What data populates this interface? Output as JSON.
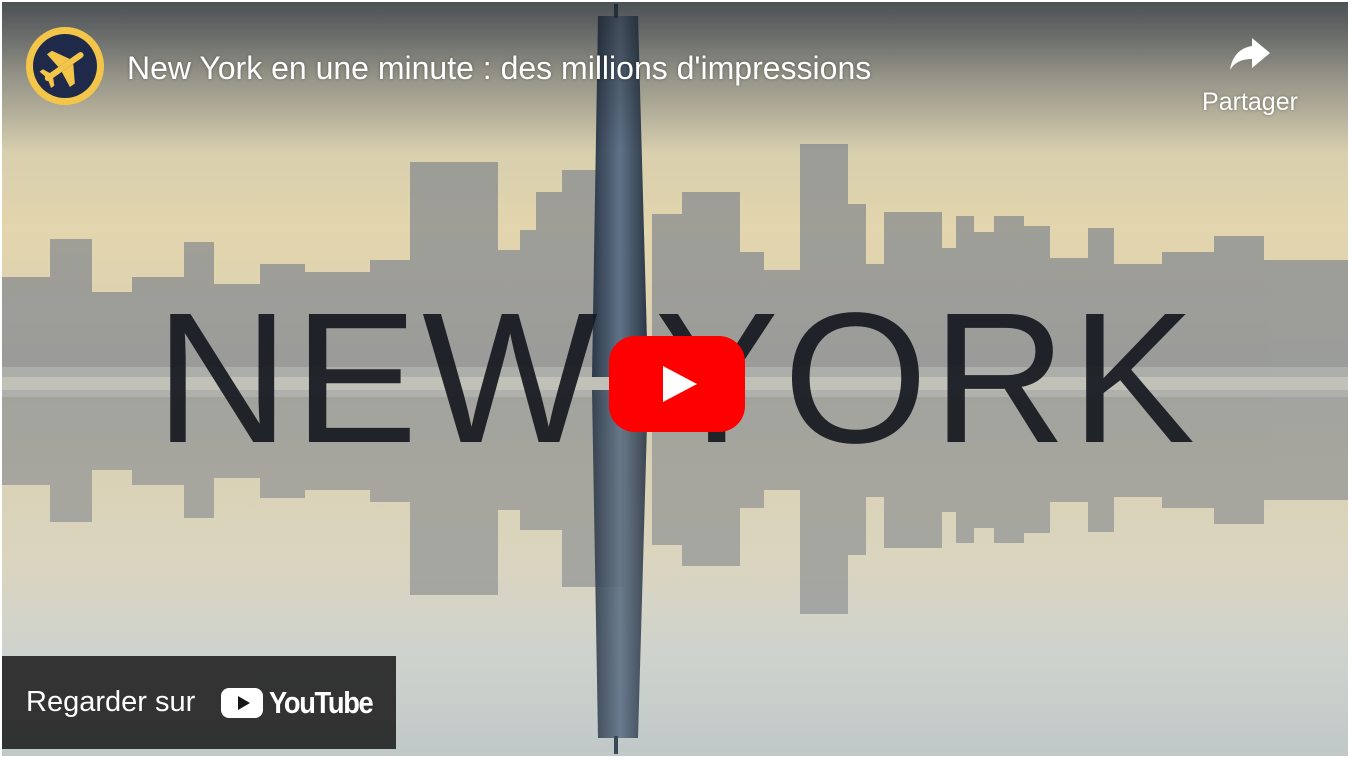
{
  "video": {
    "title": "New York en une minute : des millions d'impressions",
    "thumbnail_text": "NEW YORK"
  },
  "channel": {
    "logo_icon": "airplane-icon",
    "logo_color": "#f3c64a"
  },
  "share": {
    "label": "Partager",
    "icon": "share-arrow-icon"
  },
  "play": {
    "icon": "play-icon",
    "color": "#ff0000"
  },
  "watch_on": {
    "label": "Regarder sur",
    "brand": "YouTube"
  }
}
